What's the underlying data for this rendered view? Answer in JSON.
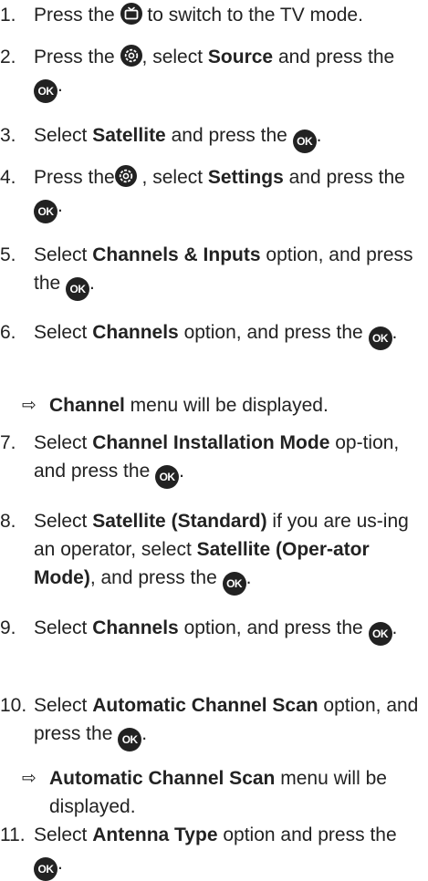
{
  "steps": [
    {
      "n": "1.",
      "t": [
        "Press the ",
        "{tv}",
        " to switch to the TV mode."
      ]
    },
    {
      "n": "2.",
      "t": [
        "Press the ",
        "{gear}",
        ", select ",
        "**Source",
        " and press the ",
        "{ok}",
        "."
      ]
    },
    {
      "n": "3.",
      "t": [
        "Select ",
        "**Satellite",
        " and press the ",
        "{ok}",
        "."
      ]
    },
    {
      "n": "4.",
      "t": [
        "Press the",
        "{gear}",
        " , select ",
        "**Settings",
        " and press the ",
        "{ok}",
        "."
      ]
    },
    {
      "n": "5.",
      "t": [
        "Select ",
        "**Channels & Inputs",
        " option, and press the ",
        "{ok}",
        "."
      ]
    },
    {
      "n": "6.",
      "t": [
        "Select ",
        "**Channels",
        " option, and press the ",
        "{ok}",
        "."
      ]
    },
    {
      "n": "7.",
      "t": [
        "Select ",
        "**Channel Installation Mode",
        " op-tion, and press the ",
        "{ok}",
        "."
      ]
    },
    {
      "n": "8.",
      "t": [
        "Select ",
        "**Satellite (Standard)",
        " if you are us-ing an operator, select ",
        "**Satellite (Oper-ator Mode)",
        ", and press the ",
        "{ok}",
        "."
      ]
    },
    {
      "n": "9.",
      "t": [
        "Select ",
        "**Channels",
        " option, and press the ",
        "{ok}",
        "."
      ]
    },
    {
      "n": "10.",
      "t": [
        "Select ",
        "**Automatic Channel Scan",
        " option, and press the ",
        "{ok}",
        "."
      ]
    },
    {
      "n": "11.",
      "t": [
        "Select ",
        "**Antenna Type",
        " option and press the ",
        "{ok}",
        "."
      ]
    }
  ],
  "results": [
    {
      "t": [
        "**Channel",
        " menu will be displayed."
      ]
    },
    {
      "t": [
        "**Automatic Channel Scan",
        " menu will be displayed."
      ]
    }
  ],
  "icons": {
    "ok_label": "OK",
    "arrow": "⇨"
  },
  "colors": {
    "text": "#222222",
    "icon_bg": "#222222",
    "icon_fg": "#ffffff"
  }
}
